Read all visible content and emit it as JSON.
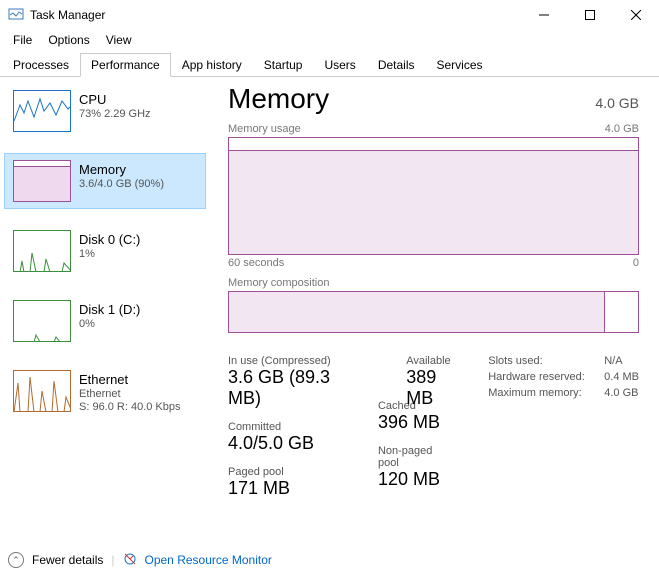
{
  "window": {
    "title": "Task Manager"
  },
  "menu": {
    "file": "File",
    "options": "Options",
    "view": "View"
  },
  "tabs": {
    "processes": "Processes",
    "performance": "Performance",
    "appHistory": "App history",
    "startup": "Startup",
    "users": "Users",
    "details": "Details",
    "services": "Services"
  },
  "sidebar": {
    "cpu": {
      "title": "CPU",
      "sub": "73%  2.29 GHz",
      "color": "#1a73c7"
    },
    "memory": {
      "title": "Memory",
      "sub": "3.6/4.0 GB (90%)",
      "color": "#9b4f96"
    },
    "disk0": {
      "title": "Disk 0 (C:)",
      "sub": "1%",
      "color": "#3b8e3b"
    },
    "disk1": {
      "title": "Disk 1 (D:)",
      "sub": "0%",
      "color": "#3b8e3b"
    },
    "ethernet": {
      "title": "Ethernet",
      "sub": "Ethernet",
      "sub2": "S: 96.0 R: 40.0 Kbps",
      "color": "#b56a2e"
    }
  },
  "main": {
    "title": "Memory",
    "capacity": "4.0 GB",
    "usageLabel": "Memory usage",
    "usageMax": "4.0 GB",
    "axisLeft": "60 seconds",
    "axisRight": "0",
    "compLabel": "Memory composition",
    "stats": {
      "inUseLabel": "In use (Compressed)",
      "inUse": "3.6 GB (89.3 MB)",
      "availableLabel": "Available",
      "available": "389 MB",
      "committedLabel": "Committed",
      "committed": "4.0/5.0 GB",
      "cachedLabel": "Cached",
      "cached": "396 MB",
      "pagedLabel": "Paged pool",
      "paged": "171 MB",
      "nonPagedLabel": "Non-paged pool",
      "nonPaged": "120 MB",
      "slotsLabel": "Slots used:",
      "slots": "N/A",
      "hwResLabel": "Hardware reserved:",
      "hwRes": "0.4 MB",
      "maxMemLabel": "Maximum memory:",
      "maxMem": "4.0 GB"
    }
  },
  "footer": {
    "fewer": "Fewer details",
    "orm": "Open Resource Monitor"
  },
  "chart_data": {
    "type": "line",
    "title": "Memory usage",
    "ylabel": "GB",
    "ylim": [
      0,
      4.0
    ],
    "xlabel": "seconds ago",
    "x": [
      60,
      55,
      50,
      45,
      40,
      35,
      30,
      25,
      20,
      15,
      10,
      5,
      0
    ],
    "values": [
      3.6,
      3.6,
      3.6,
      3.6,
      3.6,
      3.6,
      3.6,
      3.6,
      3.6,
      3.6,
      3.6,
      3.6,
      3.6
    ]
  }
}
